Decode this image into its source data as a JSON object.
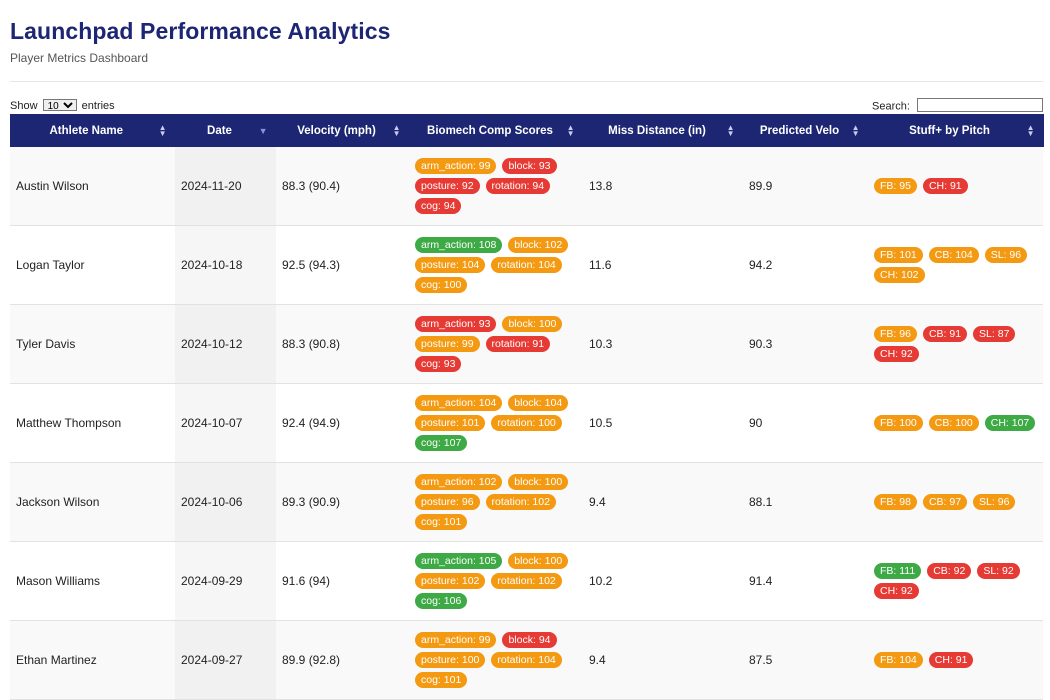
{
  "header": {
    "title": "Launchpad Performance Analytics",
    "subtitle": "Player Metrics Dashboard"
  },
  "controls": {
    "show_label": "Show",
    "entries_value": "10",
    "entries_label": "entries",
    "search_label": "Search:",
    "search_value": ""
  },
  "table": {
    "columns": [
      "Athlete Name",
      "Date",
      "Velocity (mph)",
      "Biomech Comp Scores",
      "Miss Distance (in)",
      "Predicted Velo",
      "Stuff+ by Pitch"
    ],
    "sorted_column": "Date",
    "sort_direction": "descending",
    "badge_colors": {
      "orange": "#f39a12",
      "red": "#e63a35",
      "green": "#3daa45"
    },
    "header_color": "#1c2673",
    "rows": [
      {
        "athlete": "Austin Wilson",
        "date": "2024-11-20",
        "velocity": "88.3 (90.4)",
        "biomech": [
          {
            "text": "arm_action: 99",
            "color": "orange"
          },
          {
            "text": "block: 93",
            "color": "red"
          },
          {
            "text": "posture: 92",
            "color": "red"
          },
          {
            "text": "rotation: 94",
            "color": "red"
          },
          {
            "text": "cog: 94",
            "color": "red"
          }
        ],
        "miss": "13.8",
        "predicted": "89.9",
        "stuff": [
          {
            "text": "FB: 95",
            "color": "orange"
          },
          {
            "text": "CH: 91",
            "color": "red"
          }
        ]
      },
      {
        "athlete": "Logan Taylor",
        "date": "2024-10-18",
        "velocity": "92.5 (94.3)",
        "biomech": [
          {
            "text": "arm_action: 108",
            "color": "green"
          },
          {
            "text": "block: 102",
            "color": "orange"
          },
          {
            "text": "posture: 104",
            "color": "orange"
          },
          {
            "text": "rotation: 104",
            "color": "orange"
          },
          {
            "text": "cog: 100",
            "color": "orange"
          }
        ],
        "miss": "11.6",
        "predicted": "94.2",
        "stuff": [
          {
            "text": "FB: 101",
            "color": "orange"
          },
          {
            "text": "CB: 104",
            "color": "orange"
          },
          {
            "text": "SL: 96",
            "color": "orange"
          },
          {
            "text": "CH: 102",
            "color": "orange"
          }
        ]
      },
      {
        "athlete": "Tyler Davis",
        "date": "2024-10-12",
        "velocity": "88.3 (90.8)",
        "biomech": [
          {
            "text": "arm_action: 93",
            "color": "red"
          },
          {
            "text": "block: 100",
            "color": "orange"
          },
          {
            "text": "posture: 99",
            "color": "orange"
          },
          {
            "text": "rotation: 91",
            "color": "red"
          },
          {
            "text": "cog: 93",
            "color": "red"
          }
        ],
        "miss": "10.3",
        "predicted": "90.3",
        "stuff": [
          {
            "text": "FB: 96",
            "color": "orange"
          },
          {
            "text": "CB: 91",
            "color": "red"
          },
          {
            "text": "SL: 87",
            "color": "red"
          },
          {
            "text": "CH: 92",
            "color": "red"
          }
        ]
      },
      {
        "athlete": "Matthew Thompson",
        "date": "2024-10-07",
        "velocity": "92.4 (94.9)",
        "biomech": [
          {
            "text": "arm_action: 104",
            "color": "orange"
          },
          {
            "text": "block: 104",
            "color": "orange"
          },
          {
            "text": "posture: 101",
            "color": "orange"
          },
          {
            "text": "rotation: 100",
            "color": "orange"
          },
          {
            "text": "cog: 107",
            "color": "green"
          }
        ],
        "miss": "10.5",
        "predicted": "90",
        "stuff": [
          {
            "text": "FB: 100",
            "color": "orange"
          },
          {
            "text": "CB: 100",
            "color": "orange"
          },
          {
            "text": "CH: 107",
            "color": "green"
          }
        ]
      },
      {
        "athlete": "Jackson Wilson",
        "date": "2024-10-06",
        "velocity": "89.3 (90.9)",
        "biomech": [
          {
            "text": "arm_action: 102",
            "color": "orange"
          },
          {
            "text": "block: 100",
            "color": "orange"
          },
          {
            "text": "posture: 96",
            "color": "orange"
          },
          {
            "text": "rotation: 102",
            "color": "orange"
          },
          {
            "text": "cog: 101",
            "color": "orange"
          }
        ],
        "miss": "9.4",
        "predicted": "88.1",
        "stuff": [
          {
            "text": "FB: 98",
            "color": "orange"
          },
          {
            "text": "CB: 97",
            "color": "orange"
          },
          {
            "text": "SL: 96",
            "color": "orange"
          }
        ]
      },
      {
        "athlete": "Mason Williams",
        "date": "2024-09-29",
        "velocity": "91.6 (94)",
        "biomech": [
          {
            "text": "arm_action: 105",
            "color": "green"
          },
          {
            "text": "block: 100",
            "color": "orange"
          },
          {
            "text": "posture: 102",
            "color": "orange"
          },
          {
            "text": "rotation: 102",
            "color": "orange"
          },
          {
            "text": "cog: 106",
            "color": "green"
          }
        ],
        "miss": "10.2",
        "predicted": "91.4",
        "stuff": [
          {
            "text": "FB: 111",
            "color": "green"
          },
          {
            "text": "CB: 92",
            "color": "red"
          },
          {
            "text": "SL: 92",
            "color": "red"
          },
          {
            "text": "CH: 92",
            "color": "red"
          }
        ]
      },
      {
        "athlete": "Ethan Martinez",
        "date": "2024-09-27",
        "velocity": "89.9 (92.8)",
        "biomech": [
          {
            "text": "arm_action: 99",
            "color": "orange"
          },
          {
            "text": "block: 94",
            "color": "red"
          },
          {
            "text": "posture: 100",
            "color": "orange"
          },
          {
            "text": "rotation: 104",
            "color": "orange"
          },
          {
            "text": "cog: 101",
            "color": "orange"
          }
        ],
        "miss": "9.4",
        "predicted": "87.5",
        "stuff": [
          {
            "text": "FB: 104",
            "color": "orange"
          },
          {
            "text": "CH: 91",
            "color": "red"
          }
        ]
      }
    ]
  }
}
